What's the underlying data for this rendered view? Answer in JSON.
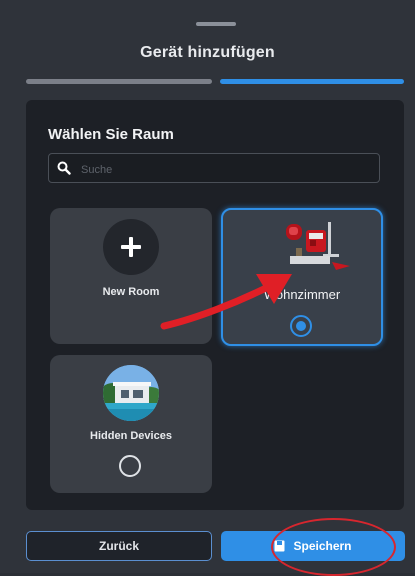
{
  "header": {
    "title": "Gerät hinzufügen"
  },
  "progress": {
    "step": 2,
    "total": 2
  },
  "panel": {
    "title": "Wählen Sie Raum",
    "search": {
      "placeholder": "Suche",
      "value": ""
    }
  },
  "rooms": [
    {
      "label": "New Room",
      "icon": "plus-icon",
      "selected": false
    },
    {
      "label": "Wohnzimmer",
      "icon": "room-photo",
      "selected": true
    },
    {
      "label": "Hidden Devices",
      "icon": "house-photo",
      "selected": false
    }
  ],
  "footer": {
    "back_label": "Zurück",
    "save_label": "Speichern"
  },
  "colors": {
    "accent": "#2f8fe6",
    "annotation": "#d7262e"
  }
}
